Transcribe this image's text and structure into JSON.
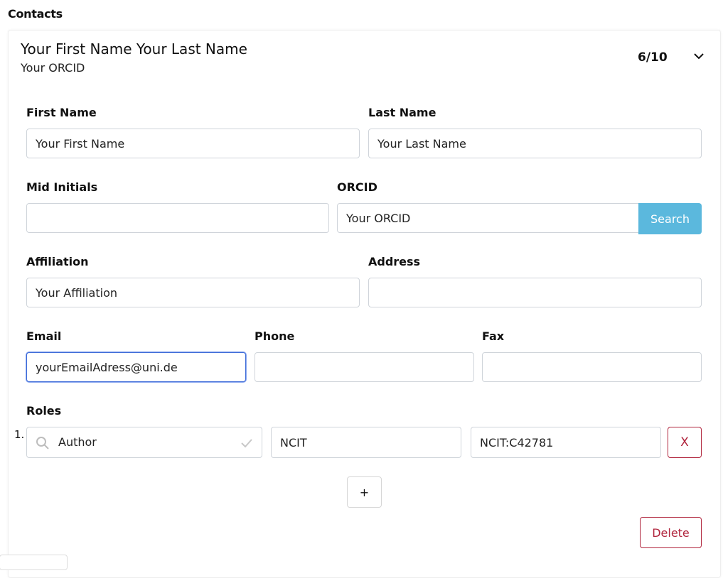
{
  "section": {
    "title": "Contacts"
  },
  "contact": {
    "title": "Your First Name Your Last Name",
    "subtitle": "Your ORCID",
    "counter": "6/10",
    "collapse_icon": "chevron-down-icon"
  },
  "form": {
    "first_name": {
      "label": "First Name",
      "value": "Your First Name"
    },
    "last_name": {
      "label": "Last Name",
      "value": "Your Last Name"
    },
    "mid_initials": {
      "label": "Mid Initials",
      "value": ""
    },
    "orcid": {
      "label": "ORCID",
      "value": "Your ORCID",
      "button": "Search"
    },
    "affiliation": {
      "label": "Affiliation",
      "value": "Your Affiliation"
    },
    "address": {
      "label": "Address",
      "value": ""
    },
    "email": {
      "label": "Email",
      "value": "yourEmailAdress@uni.de"
    },
    "phone": {
      "label": "Phone",
      "value": ""
    },
    "fax": {
      "label": "Fax",
      "value": ""
    }
  },
  "roles": {
    "label": "Roles",
    "items": [
      {
        "index": "1.",
        "term": "Author",
        "source": "NCIT",
        "accession": "NCIT:C42781",
        "remove": "X"
      }
    ],
    "add_button": "+"
  },
  "actions": {
    "delete": "Delete"
  },
  "colors": {
    "search_button": "#5bb8dd",
    "danger": "#b0243c",
    "focus_border": "#3f6cd8",
    "input_border": "#cfd4da"
  }
}
